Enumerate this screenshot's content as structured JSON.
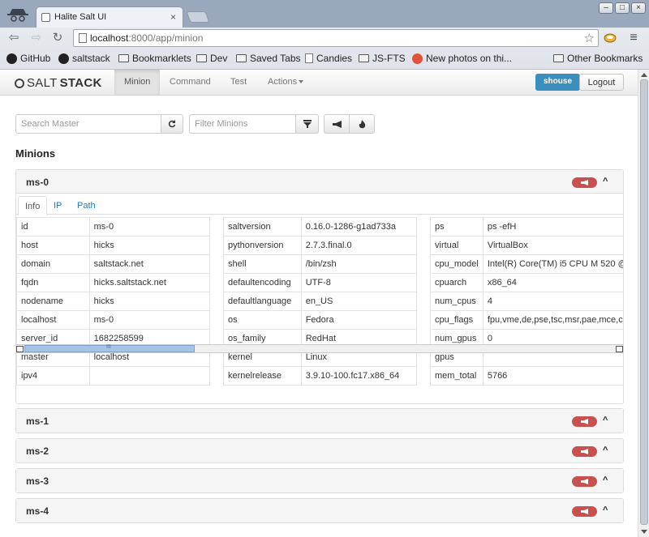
{
  "browser": {
    "tab_title": "Halite Salt UI",
    "tab_close": "×",
    "url_host": "localhost",
    "url_path": ":8000/app/minion",
    "window_buttons": [
      "–",
      "□",
      "×"
    ],
    "bookmarks": [
      {
        "label": "GitHub",
        "icon": "github-icon"
      },
      {
        "label": "saltstack",
        "icon": "github-icon"
      },
      {
        "label": "Bookmarklets",
        "icon": "folder-icon"
      },
      {
        "label": "Dev",
        "icon": "folder-icon"
      },
      {
        "label": "Saved Tabs",
        "icon": "folder-icon"
      },
      {
        "label": "Candies",
        "icon": "page-icon"
      },
      {
        "label": "JS-FTS",
        "icon": "folder-icon"
      },
      {
        "label": "New photos on thi...",
        "icon": "reddit-icon"
      }
    ],
    "other_bookmarks": "Other Bookmarks"
  },
  "app": {
    "brand_light": "SALT",
    "brand_bold": "STACK",
    "nav": [
      "Minion",
      "Command",
      "Test",
      "Actions"
    ],
    "user": "shouse",
    "logout": "Logout"
  },
  "search": {
    "master_placeholder": "Search Master",
    "minion_placeholder": "Filter Minions"
  },
  "section_title": "Minions",
  "minions": {
    "expanded": {
      "name": "ms-0",
      "tabs": [
        "Info",
        "IP",
        "Path"
      ],
      "col1": [
        [
          "id",
          "ms-0"
        ],
        [
          "host",
          "hicks"
        ],
        [
          "domain",
          "saltstack.net"
        ],
        [
          "fqdn",
          "hicks.saltstack.net"
        ],
        [
          "nodename",
          "hicks"
        ],
        [
          "localhost",
          "ms-0"
        ],
        [
          "server_id",
          "1682258599"
        ],
        [
          "master",
          "localhost"
        ],
        [
          "ipv4",
          ""
        ]
      ],
      "col2": [
        [
          "saltversion",
          "0.16.0-1286-g1ad733a"
        ],
        [
          "pythonversion",
          "2.7.3.final.0"
        ],
        [
          "shell",
          "/bin/zsh"
        ],
        [
          "defaultencoding",
          "UTF-8"
        ],
        [
          "defaultlanguage",
          "en_US"
        ],
        [
          "os",
          "Fedora"
        ],
        [
          "os_family",
          "RedHat"
        ],
        [
          "kernel",
          "Linux"
        ],
        [
          "kernelrelease",
          "3.9.10-100.fc17.x86_64"
        ]
      ],
      "col3": [
        [
          "ps",
          "ps -efH"
        ],
        [
          "virtual",
          "VirtualBox"
        ],
        [
          "cpu_model",
          "Intel(R) Core(TM) i5 CPU M 520 @"
        ],
        [
          "cpuarch",
          "x86_64"
        ],
        [
          "num_cpus",
          "4"
        ],
        [
          "cpu_flags",
          "fpu,vme,de,pse,tsc,msr,pae,mce,c"
        ],
        [
          "num_gpus",
          "0"
        ],
        [
          "gpus",
          ""
        ],
        [
          "mem_total",
          "5766"
        ]
      ]
    },
    "collapsed": [
      "ms-1",
      "ms-2",
      "ms-3",
      "ms-4"
    ]
  },
  "hscroll_grip": "III"
}
